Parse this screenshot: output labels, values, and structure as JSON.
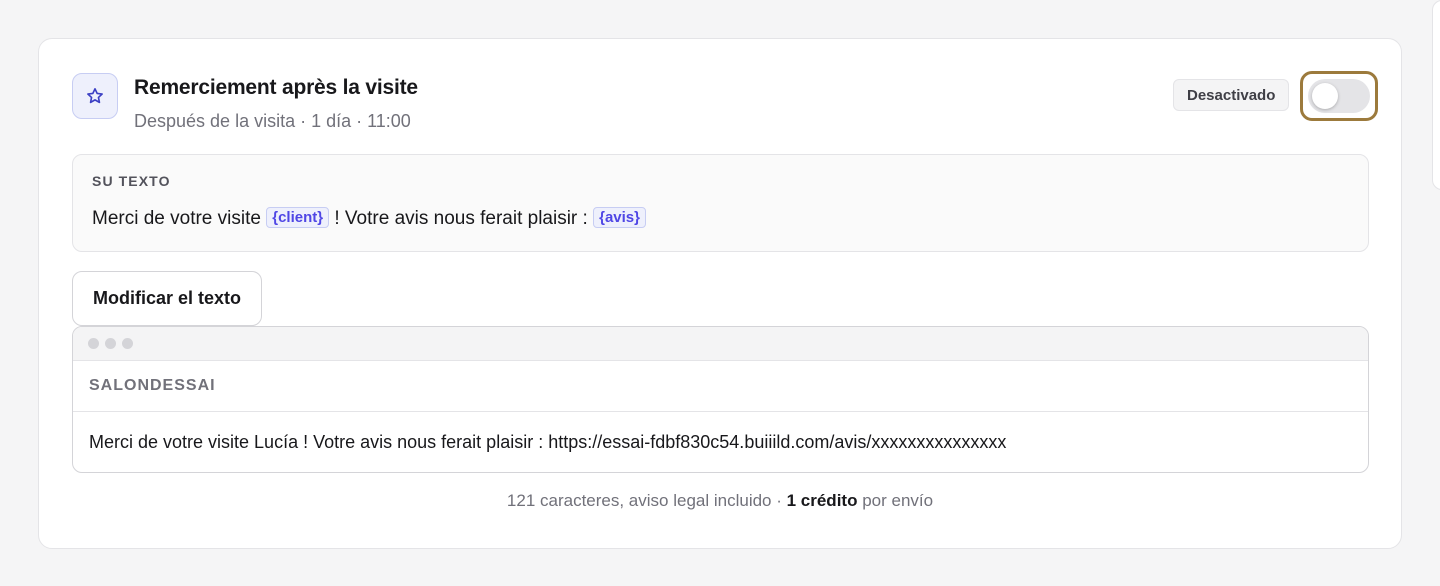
{
  "card": {
    "icon": "star-icon",
    "title": "Remerciement après la visite",
    "subtitle": "Después de la visita · 1 día · 11:00",
    "status": "Desactivado",
    "toggle_state": "off"
  },
  "template": {
    "label": "SU TEXTO",
    "text_before": "Merci de votre visite ",
    "var_client": "{client}",
    "text_middle": " ! Votre avis nous ferait plaisir : ",
    "var_avis": "{avis}"
  },
  "edit_button_label": "Modificar el texto",
  "preview": {
    "sender": "SALONDESSAI",
    "message": "Merci de votre visite Lucía ! Votre avis nous ferait plaisir : https://essai-fdbf830c54.buiiild.com/avis/xxxxxxxxxxxxxxx"
  },
  "footer": {
    "chars": "121 caracteres, aviso legal incluido · ",
    "credit": "1 crédito",
    "suffix": " por envío"
  },
  "colors": {
    "accent": "#4f46e5",
    "focus_ring": "#9c7a3c",
    "chip_bg": "#eef0fc"
  }
}
